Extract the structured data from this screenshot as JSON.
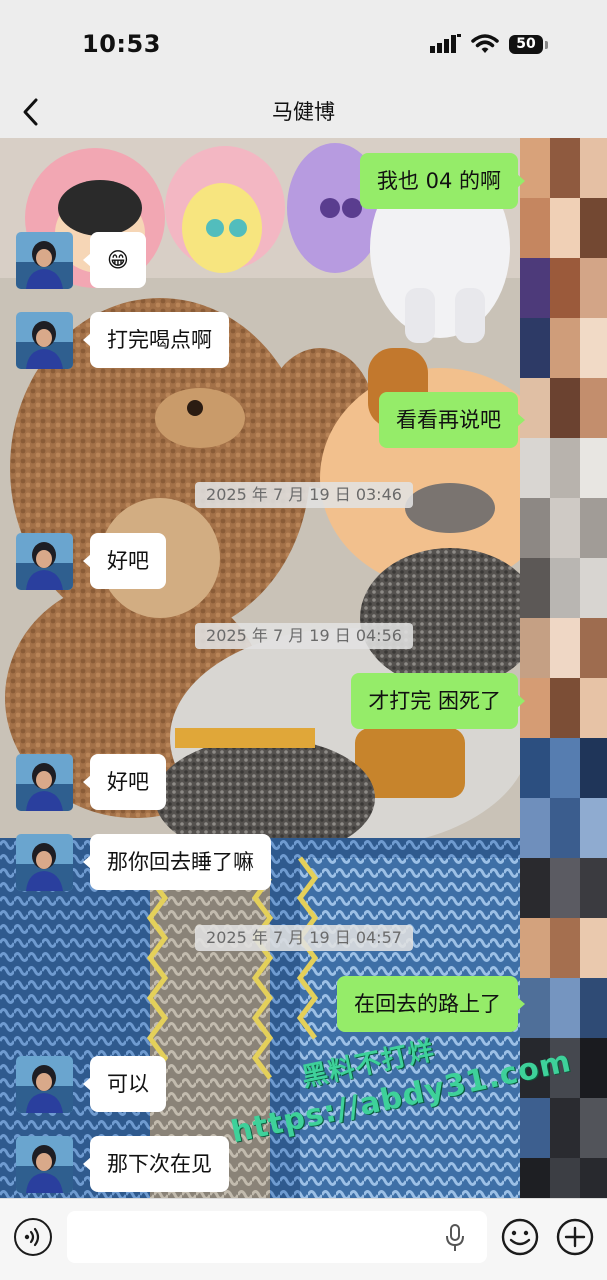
{
  "status_bar": {
    "time": "10:53",
    "battery": "50",
    "icons": [
      "signal-icon",
      "wifi-icon",
      "battery-icon"
    ]
  },
  "header": {
    "title": "马健博",
    "back_icon": "chevron-left-icon"
  },
  "messages": [
    {
      "side": "right",
      "text": "我也 04 的啊"
    },
    {
      "side": "left",
      "text": "😁"
    },
    {
      "side": "left",
      "text": "打完喝点啊"
    },
    {
      "side": "right",
      "text": "看看再说吧"
    },
    {
      "timestamp": "2025 年 7 月 19 日 03:46"
    },
    {
      "side": "left",
      "text": "好吧"
    },
    {
      "timestamp": "2025 年 7 月 19 日 04:56"
    },
    {
      "side": "right",
      "text": "才打完 困死了"
    },
    {
      "side": "left",
      "text": "好吧"
    },
    {
      "side": "left",
      "text": "那你回去睡了嘛"
    },
    {
      "timestamp": "2025 年 7 月 19 日 04:57"
    },
    {
      "side": "right",
      "text": "在回去的路上了"
    },
    {
      "side": "left",
      "text": "可以"
    },
    {
      "side": "left",
      "text": "那下次在见"
    }
  ],
  "watermark": {
    "line1": "黑料不打烊",
    "line2": "https://abdy31.com"
  },
  "input_bar": {
    "value": "",
    "icons": [
      "voice-icon",
      "microphone-icon",
      "emoji-icon",
      "plus-icon"
    ]
  },
  "colors": {
    "outgoing_bubble": "#95ec69",
    "incoming_bubble": "#ffffff",
    "watermark": "#3ed19a"
  }
}
